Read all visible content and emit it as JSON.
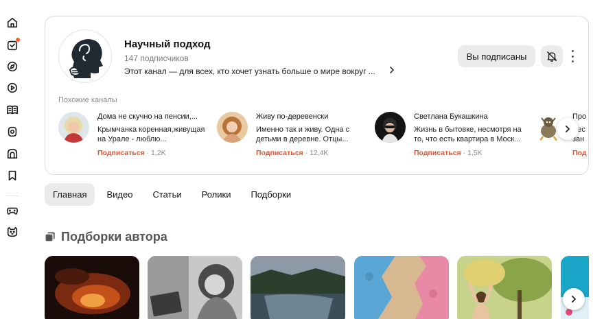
{
  "sidebar": {
    "items": [
      {
        "icon": "home-icon"
      },
      {
        "icon": "subscriptions-icon",
        "badge": true
      },
      {
        "icon": "explore-icon"
      },
      {
        "icon": "video-icon"
      },
      {
        "icon": "articles-icon"
      },
      {
        "icon": "shorts-icon"
      },
      {
        "icon": "kids-icon"
      },
      {
        "icon": "bookmark-icon"
      },
      {
        "icon": "games-icon"
      },
      {
        "icon": "pets-icon"
      }
    ]
  },
  "channel": {
    "title": "Научный подход",
    "subscribers": "147 подписчиков",
    "description": "Этот канал — для всех, кто хочет узнать больше о мире вокруг ...",
    "subscribed_label": "Вы подписаны",
    "similar_label": "Похожие каналы",
    "similar": [
      {
        "name": "Дома не скучно на пенсии,...",
        "desc": "Крымчанка коренная,живущая на Урале - люблю...",
        "action": "Подписаться",
        "count": " · 1,2K"
      },
      {
        "name": "Живу по-деревенски",
        "desc": "Именно так и живу. Одна с детьми в деревне. Отцы...",
        "action": "Подписаться",
        "count": " · 12,4K"
      },
      {
        "name": "Светлана Букашкина",
        "desc": "Жизнь в бытовке, несмотря на то, что есть квартира в Моск...",
        "action": "Подписаться",
        "count": " · 1,5K"
      },
      {
        "name": "Про",
        "desc": "Леc зан",
        "action": "Под",
        "count": ""
      }
    ]
  },
  "tabs": [
    {
      "label": "Главная",
      "active": true
    },
    {
      "label": "Видео",
      "active": false
    },
    {
      "label": "Статьи",
      "active": false
    },
    {
      "label": "Ролики",
      "active": false
    },
    {
      "label": "Подборки",
      "active": false
    }
  ],
  "section": {
    "title": "Подборки автора"
  },
  "colors": {
    "accent": "#e8522b",
    "badge": "#ff5a2b",
    "button_bg": "#ebebeb"
  }
}
